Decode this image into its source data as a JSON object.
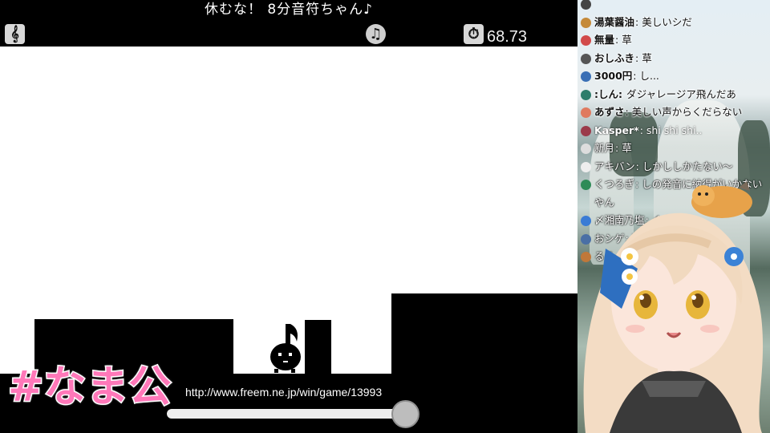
{
  "game": {
    "title": "休むな！ 8分音符ちゃん♪",
    "timer": "68.73",
    "url": "http://www.freem.ne.jp/win/game/13993",
    "icons": [
      "treble-clef-icon",
      "music-note-icon",
      "stopwatch-icon"
    ],
    "colors": {
      "background": "#ffffff",
      "blocks": "#000000"
    }
  },
  "overlay": {
    "hashtag": "#なま公",
    "hashtag_color": "#ff78b9"
  },
  "chat": {
    "messages": [
      {
        "author": "",
        "text": "",
        "color": "#444"
      },
      {
        "author": "湯葉醤油",
        "text": "美しいシだ",
        "color": "#c58a3a"
      },
      {
        "author": "無量",
        "text": "草",
        "color": "#d24a4a"
      },
      {
        "author": "おしふき",
        "text": "草",
        "color": "#555555"
      },
      {
        "author": "3000円",
        "text": "し...",
        "color": "#3a6fb5"
      },
      {
        "author": ":しん:",
        "text": "ダジャレージア飛んだあ",
        "color": "#2e7d6b"
      },
      {
        "author": "あずさ",
        "text": "美しい声からくだらない",
        "color": "#e07a5f"
      },
      {
        "author": "Kasper*",
        "text": "shi shi shi..",
        "color": "#9b3a4a"
      },
      {
        "author": "新月",
        "text": "草",
        "color": "#ffffff"
      },
      {
        "author": "アキバン",
        "text": "しかししかたない〜",
        "color": "#ffffff"
      },
      {
        "author": "くつろぎ",
        "text": "しの発音に納得がいかない",
        "color": "#2e8b57"
      },
      {
        "author": "",
        "text": "やん",
        "color": ""
      },
      {
        "author": "〆湘南乃塩",
        "text": "くさ",
        "color": "#3a7bd5"
      },
      {
        "author": "おシゲ",
        "text": "草",
        "color": "#4a6fa5"
      },
      {
        "author": "るる",
        "text": "",
        "color": "#c0783a"
      }
    ]
  }
}
